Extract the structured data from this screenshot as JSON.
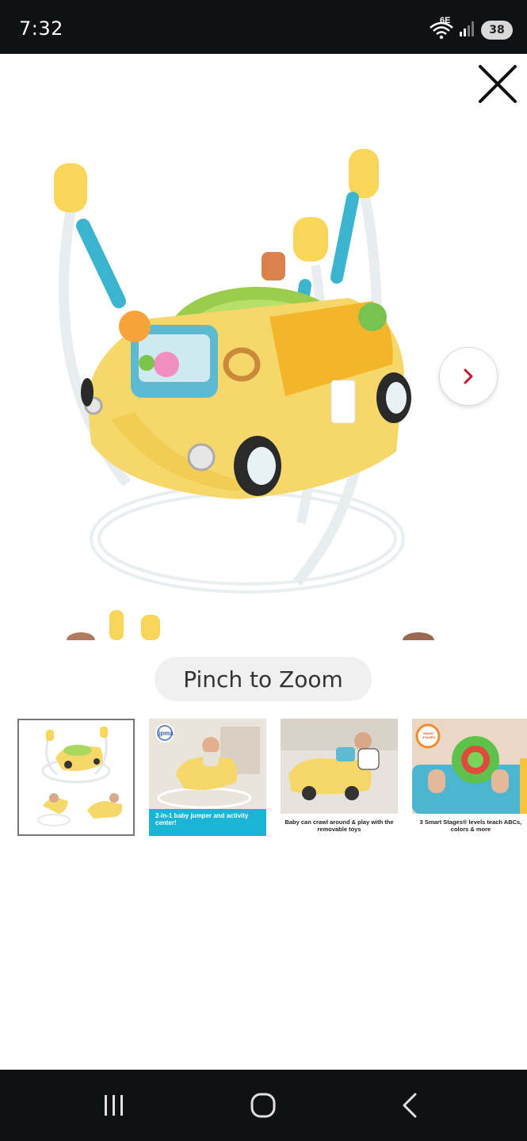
{
  "status_bar": {
    "time": "7:32",
    "network": "6E",
    "battery": "38",
    "icons": [
      "wifi-icon",
      "signal-icon",
      "battery-icon"
    ]
  },
  "viewer": {
    "close_icon": "close-icon",
    "next_icon": "chevron-right-icon",
    "zoom_hint": "Pinch to Zoom",
    "accent_color": "#c8102e"
  },
  "thumbnails": [
    {
      "caption": "",
      "selected": true
    },
    {
      "caption": "2-in-1 baby jumper and activity center!",
      "badge": "jpma",
      "selected": false
    },
    {
      "caption": "Baby can crawl around & play with the removable toys",
      "selected": false
    },
    {
      "caption": "3 Smart Stages® levels teach ABCs, colors & more",
      "badge": "SMART STAGES",
      "selected": false
    }
  ],
  "nav_bar": {
    "items": [
      "recent-apps-icon",
      "home-icon",
      "back-icon"
    ]
  }
}
